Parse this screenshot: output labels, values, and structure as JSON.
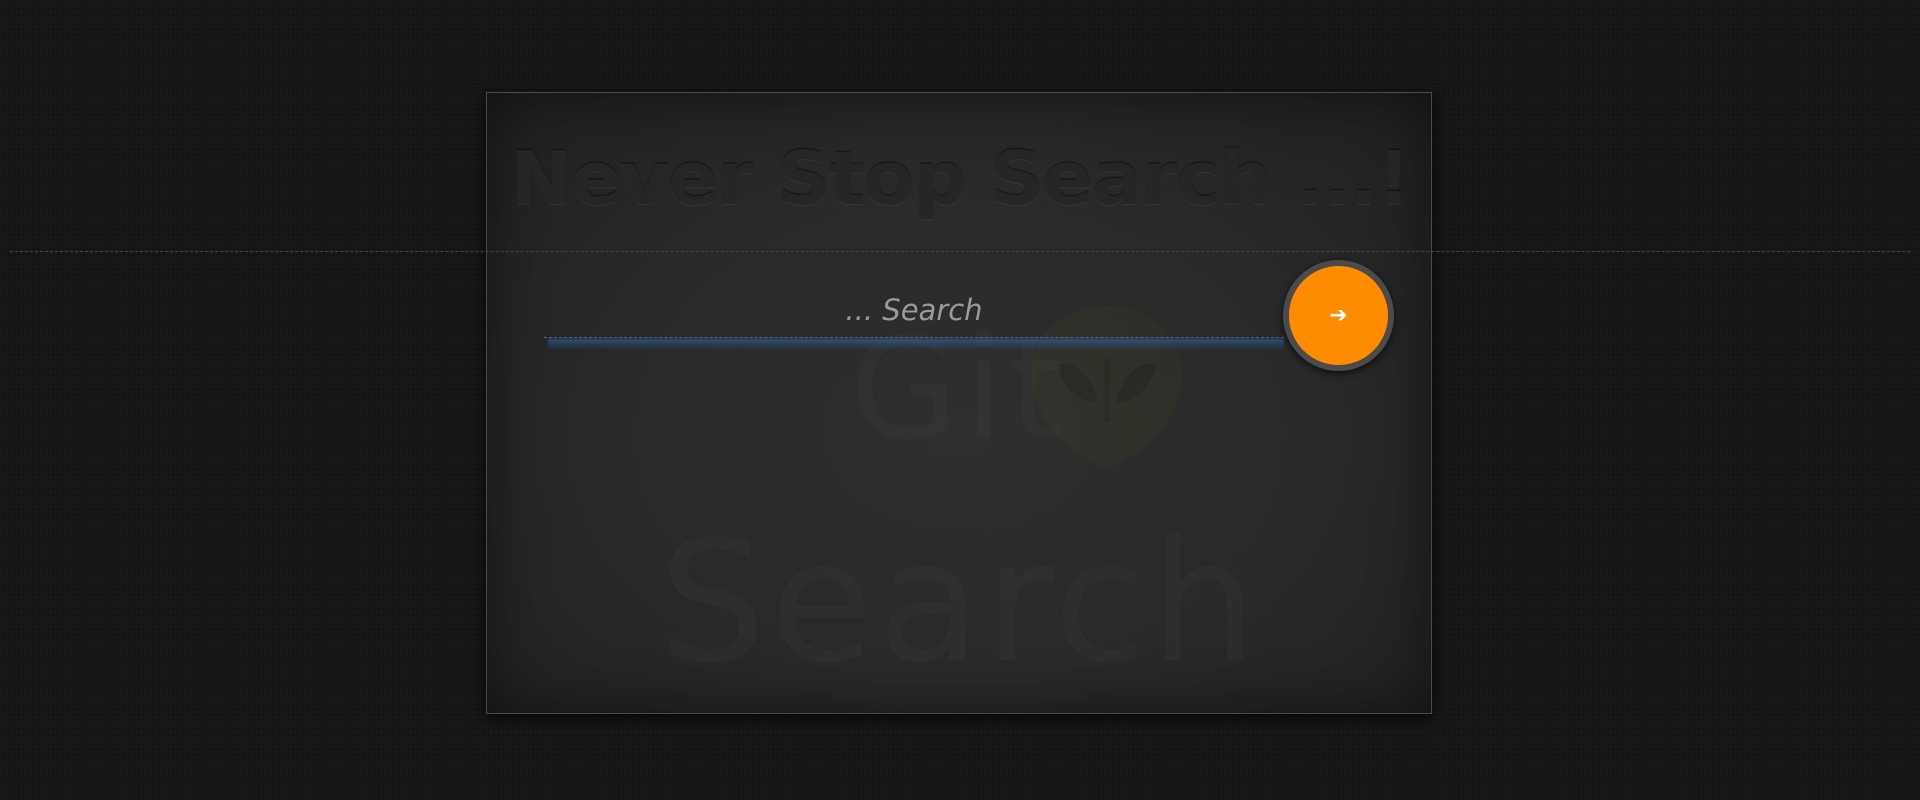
{
  "headline": "Never Stop Search ...!",
  "search": {
    "placeholder": "... Search",
    "button_icon": "arrow-right-icon",
    "button_glyph": "➔"
  },
  "watermark": {
    "line1": "Git",
    "line2": "Search",
    "logo_icon": "alien-head-icon"
  },
  "colors": {
    "accent": "#ff8c00",
    "focus_underline": "#305a96",
    "page_background": "#161616",
    "card_background": "#2a2a2a"
  }
}
